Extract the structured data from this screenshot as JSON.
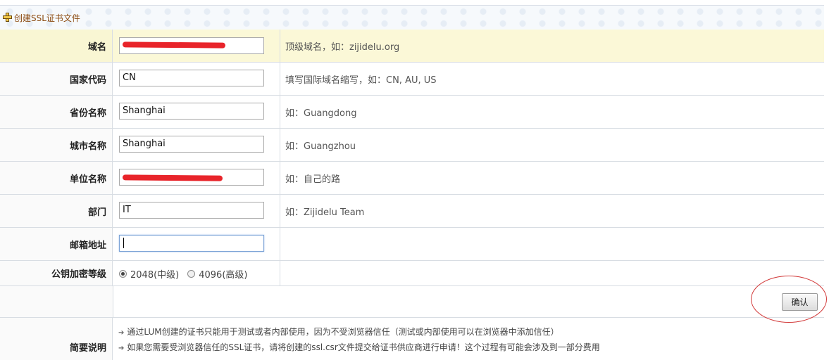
{
  "header": {
    "title": "创建SSL证书文件",
    "icon": "plus-icon"
  },
  "form": {
    "rows": [
      {
        "label": "域名",
        "value": "",
        "redacted": true,
        "hint": "顶级域名，如：zijidelu.org",
        "highlight": true
      },
      {
        "label": "国家代码",
        "value": "CN",
        "hint": "填写国际域名缩写，如：CN, AU, US"
      },
      {
        "label": "省份名称",
        "value": "Shanghai",
        "hint": "如：Guangdong"
      },
      {
        "label": "城市名称",
        "value": "Shanghai",
        "hint": "如：Guangzhou"
      },
      {
        "label": "单位名称",
        "value": "",
        "redacted": true,
        "hint": "如：自己的路"
      },
      {
        "label": "部门",
        "value": "IT",
        "hint": "如：Zijidelu Team"
      },
      {
        "label": "邮箱地址",
        "value": "",
        "hint": ""
      }
    ],
    "encryption": {
      "label": "公钥加密等级",
      "options": [
        {
          "label": "2048(中级)",
          "checked": true
        },
        {
          "label": "4096(高级)",
          "checked": false
        }
      ]
    },
    "confirm_label": "确认",
    "summary": {
      "label": "简要说明",
      "lines": [
        "通过LUM创建的证书只能用于测试或者内部使用，因为不受浏览器信任（测试或内部使用可以在浏览器中添加信任）",
        "如果您需要受浏览器信任的SSL证书，请将创建的ssl.csr文件提交给证书供应商进行申请！这个过程有可能会涉及到一部分费用"
      ]
    }
  },
  "colors": {
    "highlight_row": "#fbf8d7",
    "annotation_red": "#d23a3a",
    "title_brown": "#8b4a10"
  }
}
